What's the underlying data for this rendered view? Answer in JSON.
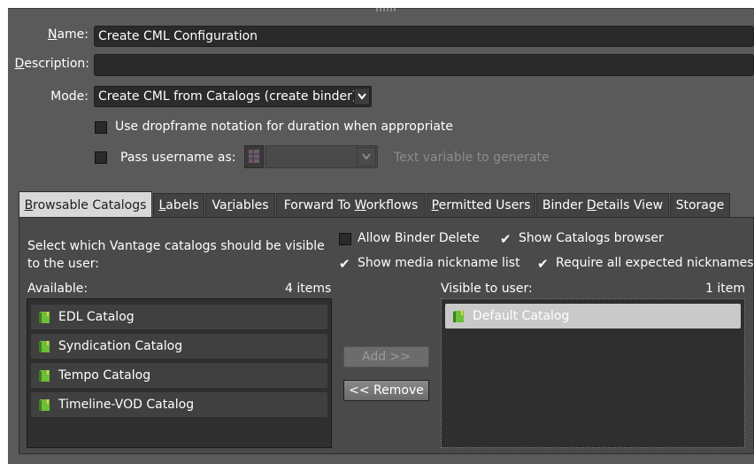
{
  "form": {
    "name_label": "Name:",
    "name_value": "Create CML Configuration",
    "description_label": "Description:",
    "description_value": "",
    "mode_label": "Mode:",
    "mode_value": "Create CML from Catalogs (create binder)",
    "dropframe_label": "Use dropframe notation for duration when appropriate",
    "dropframe_checked": false,
    "pass_username_label": "Pass username as:",
    "pass_username_checked": false,
    "text_variable_hint": "Text variable to generate"
  },
  "tabs": [
    {
      "label": "Browsable Catalogs",
      "active": true
    },
    {
      "label": "Labels",
      "active": false
    },
    {
      "label": "Variables",
      "active": false
    },
    {
      "label": "Forward To Workflows",
      "active": false
    },
    {
      "label": "Permitted Users",
      "active": false
    },
    {
      "label": "Binder Details View",
      "active": false
    },
    {
      "label": "Storage",
      "active": false
    }
  ],
  "panel": {
    "instructions": "Select which Vantage catalogs should be visible to the user:",
    "options": {
      "allow_binder_delete": {
        "label": "Allow Binder Delete",
        "checked": false
      },
      "show_catalogs_browser": {
        "label": "Show Catalogs browser",
        "checked": true
      },
      "show_media_nickname": {
        "label": "Show media nickname list",
        "checked": true
      },
      "require_nicknames": {
        "label": "Require all expected nicknames",
        "checked": true
      }
    },
    "available": {
      "label": "Available:",
      "count": "4 items",
      "items": [
        "EDL Catalog",
        "Syndication Catalog",
        "Tempo Catalog",
        "Timeline-VOD Catalog"
      ]
    },
    "visible": {
      "label": "Visible to user:",
      "count": "1 item",
      "items": [
        "Default Catalog"
      ]
    },
    "add_button": "Add >>",
    "remove_button": "<< Remove"
  },
  "colors": {
    "background": "#5a5a5a",
    "field": "#2a2a2a",
    "active_tab": "#d8d8d8",
    "catalog_icon": "#6cbf3a"
  },
  "icons": {
    "catalog": "catalog-book-icon",
    "dropdown": "chevron-down-icon",
    "variable": "variable-grid-icon",
    "check": "checkmark-icon"
  }
}
